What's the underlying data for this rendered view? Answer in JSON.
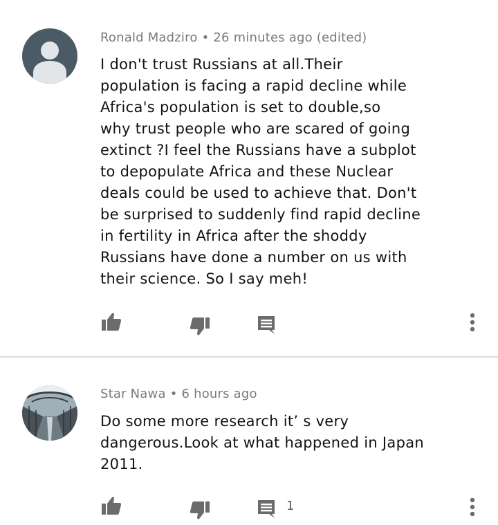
{
  "comments": [
    {
      "author": "Ronald Madziro",
      "separator": "•",
      "time": "26 minutes ago (edited)",
      "text_lines": [
        "I don't trust Russians at all.Their",
        "population is facing a rapid decline while",
        "Africa's population is set to double,so",
        "why trust people who are scared of going",
        "extinct ?I feel the Russians have a subplot",
        "to depopulate Africa and these Nuclear",
        "deals could be used to achieve that. Don't",
        "be surprised to suddenly find rapid decline",
        "in fertility in Africa after the shoddy",
        "Russians have done a number on us with",
        "their science. So I say meh!"
      ],
      "avatar_icon": "default-user-icon",
      "reply_count": ""
    },
    {
      "author": "Star Nawa",
      "separator": "•",
      "time": "6 hours ago",
      "text_lines": [
        "Do some more research it’ s very",
        "dangerous.Look at what happened in Japan",
        "2011."
      ],
      "avatar_icon": "bridge-photo-avatar",
      "reply_count": "1"
    }
  ],
  "icons": {
    "like": "thumbs-up-icon",
    "dislike": "thumbs-down-icon",
    "reply": "comment-icon",
    "more": "more-vert-icon"
  },
  "colors": {
    "icon": "#6b6b6b",
    "meta_text": "#7a7a7a",
    "body_text": "#121212",
    "divider": "#dcdcdc",
    "default_avatar": "#4b5b66"
  }
}
